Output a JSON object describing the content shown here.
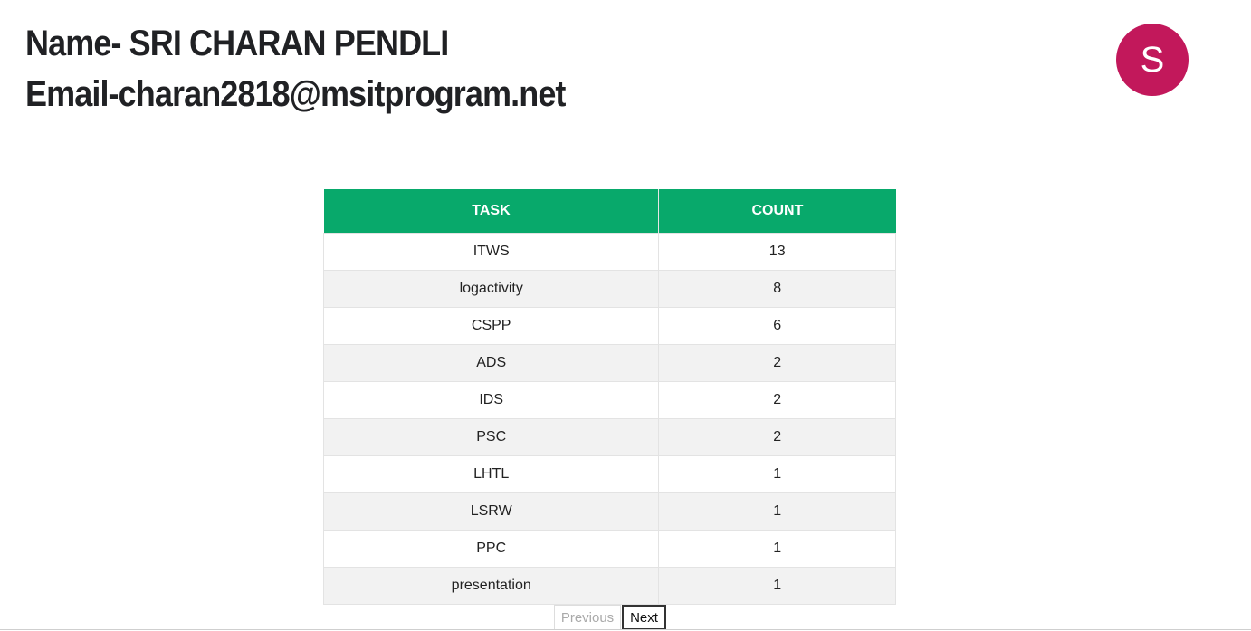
{
  "header": {
    "name_line": "Name- SRI CHARAN PENDLI",
    "email_line": "Email-charan2818@msitprogram.net"
  },
  "avatar": {
    "letter": "S",
    "color": "#c2185b"
  },
  "table": {
    "columns": [
      "TASK",
      "COUNT"
    ],
    "header_color": "#08a96b",
    "rows": [
      {
        "task": "ITWS",
        "count": "13"
      },
      {
        "task": "logactivity",
        "count": "8"
      },
      {
        "task": "CSPP",
        "count": "6"
      },
      {
        "task": "ADS",
        "count": "2"
      },
      {
        "task": "IDS",
        "count": "2"
      },
      {
        "task": "PSC",
        "count": "2"
      },
      {
        "task": "LHTL",
        "count": "1"
      },
      {
        "task": "LSRW",
        "count": "1"
      },
      {
        "task": "PPC",
        "count": "1"
      },
      {
        "task": "presentation",
        "count": "1"
      }
    ]
  },
  "pagination": {
    "previous_label": "Previous",
    "next_label": "Next"
  }
}
